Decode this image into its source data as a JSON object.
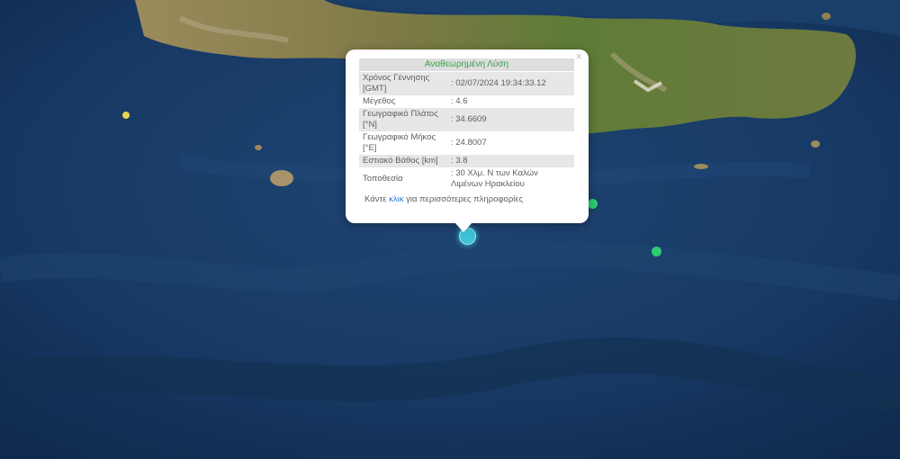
{
  "popup": {
    "title": "Αναθεωρημένη Λύση",
    "close_glyph": "×",
    "rows": [
      {
        "label": "Χρόνος Γέννησης [GMT]",
        "value": ": 02/07/2024 19:34:33.12"
      },
      {
        "label": "Μέγεθος",
        "value": ": 4.6"
      },
      {
        "label": "Γεωγραφικό Πλάτος [°N]",
        "value": ": 34.6609"
      },
      {
        "label": "Γεωγραφικό Μήκος [°E]",
        "value": ": 24.8007"
      },
      {
        "label": "Εστιακό Βάθος [km]",
        "value": ": 3.8"
      },
      {
        "label": "Τοποθεσία",
        "value": ": 30 Χλμ. Ν των Καλών Λιμένων Ηρακλείου"
      }
    ],
    "footer_prefix": "Κάντε ",
    "footer_link": "κλικ",
    "footer_suffix": " για περισσότερες πληροφορίες"
  },
  "markers": [
    {
      "name": "earthquake-marker-yellow",
      "color": "#e8d44d"
    },
    {
      "name": "earthquake-marker-green",
      "color": "#2ecc71"
    },
    {
      "name": "earthquake-marker-green",
      "color": "#2ecc71"
    },
    {
      "name": "earthquake-marker-selected",
      "color": "#3fc1d6"
    }
  ],
  "colors": {
    "sea": "#17365e",
    "land": "#8f7f52",
    "vegetation": "#5e7a34",
    "title_text": "#3aa14b",
    "link": "#2f7bd4"
  }
}
